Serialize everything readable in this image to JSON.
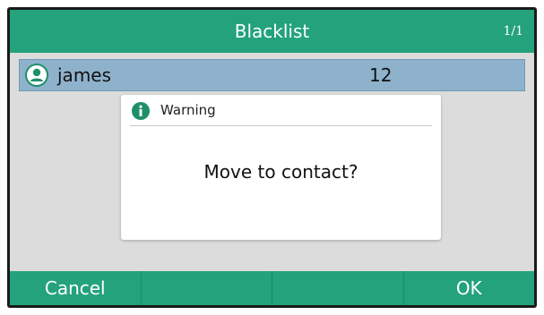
{
  "header": {
    "title": "Blacklist",
    "page_indicator": "1/1"
  },
  "list": {
    "items": [
      {
        "name": "james",
        "number": "12",
        "icon": "contact-avatar-icon",
        "selected": true
      }
    ]
  },
  "dialog": {
    "title": "Warning",
    "icon": "info-icon",
    "message": "Move to contact?"
  },
  "softkeys": [
    "Cancel",
    "",
    "",
    "OK"
  ],
  "colors": {
    "accent": "#23a27b",
    "selection": "#8fb2cc",
    "background": "#dcdcdc"
  }
}
